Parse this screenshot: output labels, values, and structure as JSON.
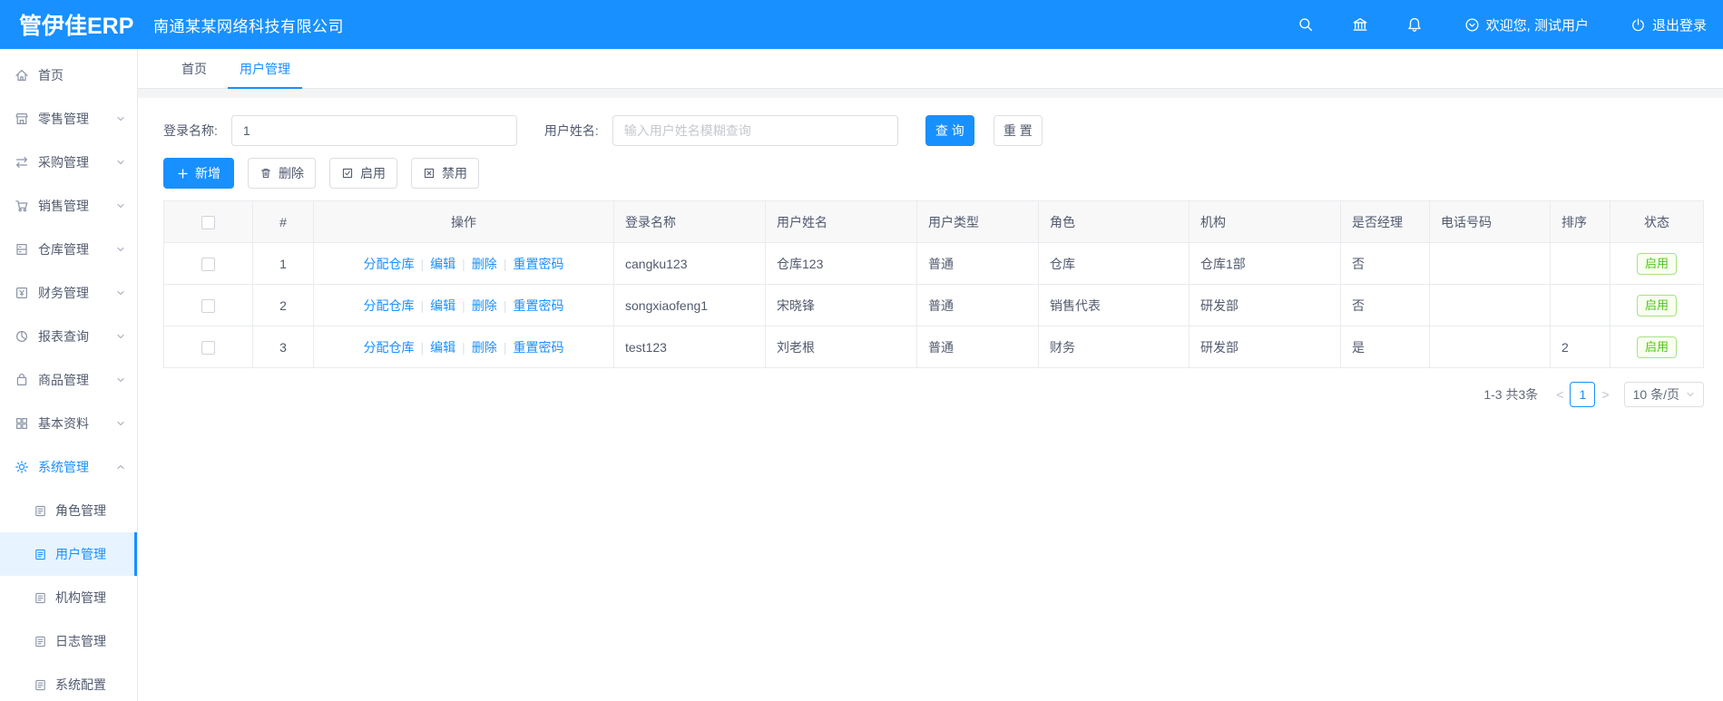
{
  "colors": {
    "primary": "#1890ff",
    "success_text": "#52c41a",
    "success_border": "#a9e185",
    "topbar_bg": "#1890ff",
    "active_submenu_bg": "#e7f4ff"
  },
  "topbar": {
    "logo": "管伊佳ERP",
    "company": "南通某某网络科技有限公司",
    "welcome": "欢迎您, 测试用户",
    "logout": "退出登录"
  },
  "sidebar": {
    "items": [
      {
        "label": "首页"
      },
      {
        "label": "零售管理"
      },
      {
        "label": "采购管理"
      },
      {
        "label": "销售管理"
      },
      {
        "label": "仓库管理"
      },
      {
        "label": "财务管理"
      },
      {
        "label": "报表查询"
      },
      {
        "label": "商品管理"
      },
      {
        "label": "基本资料"
      },
      {
        "label": "系统管理"
      }
    ],
    "submenu": [
      {
        "label": "角色管理"
      },
      {
        "label": "用户管理"
      },
      {
        "label": "机构管理"
      },
      {
        "label": "日志管理"
      },
      {
        "label": "系统配置"
      }
    ]
  },
  "tabs": [
    {
      "label": "首页"
    },
    {
      "label": "用户管理"
    }
  ],
  "search": {
    "login_label": "登录名称:",
    "login_value": "1",
    "name_label": "用户姓名:",
    "name_placeholder": "输入用户姓名模糊查询",
    "query_button": "查 询",
    "reset_button": "重 置"
  },
  "toolbar": {
    "add": "新增",
    "delete": "删除",
    "enable": "启用",
    "disable": "禁用"
  },
  "table": {
    "headers": [
      "#",
      "操作",
      "登录名称",
      "用户姓名",
      "用户类型",
      "角色",
      "机构",
      "是否经理",
      "电话号码",
      "排序",
      "状态"
    ],
    "actions": [
      "分配仓库",
      "编辑",
      "删除",
      "重置密码"
    ],
    "rows": [
      {
        "index": "1",
        "login": "cangku123",
        "name": "仓库123",
        "type": "普通",
        "role": "仓库",
        "org": "仓库1部",
        "manager": "否",
        "phone": "",
        "sort": "",
        "status": "启用"
      },
      {
        "index": "2",
        "login": "songxiaofeng1",
        "name": "宋晓锋",
        "type": "普通",
        "role": "销售代表",
        "org": "研发部",
        "manager": "否",
        "phone": "",
        "sort": "",
        "status": "启用"
      },
      {
        "index": "3",
        "login": "test123",
        "name": "刘老根",
        "type": "普通",
        "role": "财务",
        "org": "研发部",
        "manager": "是",
        "phone": "",
        "sort": "2",
        "status": "启用"
      }
    ]
  },
  "pagination": {
    "total": "1-3 共3条",
    "prev": "<",
    "page": "1",
    "next": ">",
    "page_size": "10 条/页"
  }
}
